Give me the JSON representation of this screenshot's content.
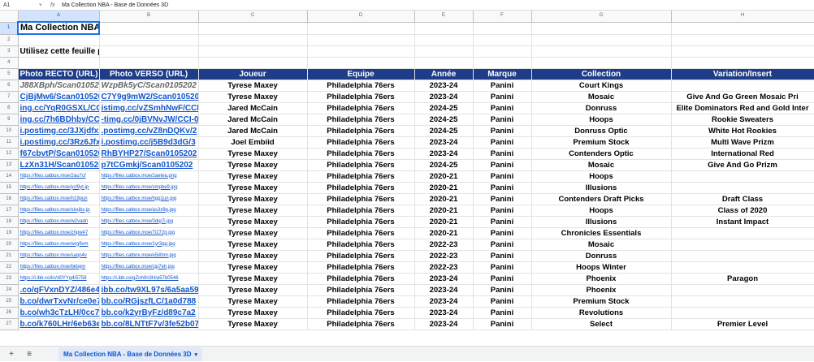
{
  "formula_bar": {
    "cell_ref": "A1",
    "fx": "fx",
    "value": "Ma Collection NBA - Base de Données 3D"
  },
  "sheet": {
    "columns": [
      "A",
      "B",
      "C",
      "D",
      "E",
      "F",
      "G",
      "H"
    ],
    "title": "Ma Collection NBA -",
    "instruction": "Utilisez cette feuille p",
    "headers": [
      "Photo RECTO (URL)",
      "Photo VERSO (URL)",
      "Joueur",
      "Equipe",
      "Année",
      "Marque",
      "Collection",
      "Variation/Insert"
    ],
    "rows": [
      {
        "n": "6",
        "a": "J88XBph/Scan010520",
        "b": "WzpBk5yC/Scan0105202",
        "j": "Tyrese Maxey",
        "e": "Philadelphia 76ers",
        "y": "2023-24",
        "m": "Panini",
        "c": "Court Kings",
        "v": ""
      },
      {
        "n": "7",
        "a": "CjBjMw6/Scan010520",
        "b": "C7Y9g9mW2/Scan0105202",
        "j": "Tyrese Maxey",
        "e": "Philadelphia 76ers",
        "y": "2023-24",
        "m": "Panini",
        "c": "Mosaic",
        "v": "Give And Go Green Mosaic Pri"
      },
      {
        "n": "8",
        "a": "ing.cc/YqR0GSXL/CCI",
        "b": "istimg.cc/vZSmhNwF/CCI-",
        "j": "Jared McCain",
        "e": "Philadelphia 76ers",
        "y": "2024-25",
        "m": "Panini",
        "c": "Donruss",
        "v": "Elite Dominators Red and Gold Inter"
      },
      {
        "n": "9",
        "a": "ing.cc/7h6BDhby/CCI",
        "b": "-timg.cc/0jBVNvJW/CCI-00",
        "j": "Jared McCain",
        "e": "Philadelphia 76ers",
        "y": "2024-25",
        "m": "Panini",
        "c": "Hoops",
        "v": "Rookie Sweaters"
      },
      {
        "n": "10",
        "a": "i.postimg.cc/3JXjdfxFi",
        "b": ".postimg.cc/vZ8nDQKv/2",
        "j": "Jared McCain",
        "e": "Philadelphia 76ers",
        "y": "2024-25",
        "m": "Panini",
        "c": "Donruss Optic",
        "v": "White Hot Rookies"
      },
      {
        "n": "11",
        "a": "i.postimg.cc/3Rz6Jfx",
        "b": "i.postimg.cc/j5B9d3dG/3",
        "j": "Joel Embiid",
        "e": "Philadelphia 76ers",
        "y": "2023-24",
        "m": "Panini",
        "c": "Premium Stock",
        "v": "Multi Wave Prizm"
      },
      {
        "n": "12",
        "a": "f67cbvtP/Scan010520",
        "b": "RhBYHP27/Scan0105202",
        "j": "Tyrese Maxey",
        "e": "Philadelphia 76ers",
        "y": "2023-24",
        "m": "Panini",
        "c": "Contenders Optic",
        "v": "International Red"
      },
      {
        "n": "13",
        "a": "LzXn31H/Scan010520",
        "b": "p7tCGmkj/Scan0105202",
        "j": "Tyrese Maxey",
        "e": "Philadelphia 76ers",
        "y": "2024-25",
        "m": "Panini",
        "c": "Mosaic",
        "v": "Give And Go Prizm"
      },
      {
        "n": "14",
        "a": "https://files.catbox.moe/2au7cf",
        "b": "https://files.catbox.moe/2aetea.png",
        "j": "Tyrese Maxey",
        "e": "Philadelphia 76ers",
        "y": "2020-21",
        "m": "Panini",
        "c": "Hoops",
        "v": ""
      },
      {
        "n": "15",
        "a": "https://files.catbox.moe/ycl9yt.jp",
        "b": "https://files.catbox.moe/smpbe9.jpg",
        "j": "Tyrese Maxey",
        "e": "Philadelphia 76ers",
        "y": "2020-21",
        "m": "Panini",
        "c": "Illusions",
        "v": ""
      },
      {
        "n": "16",
        "a": "https://files.catbox.moe/h19pun",
        "b": "https://files.catbox.moe/hgg1un.jpg",
        "j": "Tyrese Maxey",
        "e": "Philadelphia 76ers",
        "y": "2020-21",
        "m": "Panini",
        "c": "Contenders Draft Picks",
        "v": "Draft Class"
      },
      {
        "n": "17",
        "a": "https://files.catbox.moe/skxjbx.jp",
        "b": "https://files.catbox.moe/as3x9g.jpg",
        "j": "Tyrese Maxey",
        "e": "Philadelphia 76ers",
        "y": "2020-21",
        "m": "Panini",
        "c": "Hoops",
        "v": "Class of 2020"
      },
      {
        "n": "18",
        "a": "https://files.catbox.moe/w2vadn",
        "b": "https://files.catbox.moe/0dig7i.jpg",
        "j": "Tyrese Maxey",
        "e": "Philadelphia 76ers",
        "y": "2020-21",
        "m": "Panini",
        "c": "Illusions",
        "v": "Instant Impact"
      },
      {
        "n": "19",
        "a": "https://files.catbox.moe/zhpw47",
        "b": "https://files.catbox.moe/7i272p.jpg",
        "j": "Tyrese Maxey",
        "e": "Philadelphia 76ers",
        "y": "2020-21",
        "m": "Panini",
        "c": "Chronicles Essentials",
        "v": ""
      },
      {
        "n": "20",
        "a": "https://files.catbox.moe/wrg9vm",
        "b": "https://files.catbox.moe/1yr3gg.jpg",
        "j": "Tyrese Maxey",
        "e": "Philadelphia 76ers",
        "y": "2022-23",
        "m": "Panini",
        "c": "Mosaic",
        "v": ""
      },
      {
        "n": "21",
        "a": "https://files.catbox.moe/saqn4v",
        "b": "https://files.catbox.moe/e5il0mr.jpg",
        "j": "Tyrese Maxey",
        "e": "Philadelphia 76ers",
        "y": "2022-23",
        "m": "Panini",
        "c": "Donruss",
        "v": ""
      },
      {
        "n": "22",
        "a": "https://files.catbox.moe/bktejm",
        "b": "https://files.catbox.moe/cjp7eh.jpg",
        "j": "Tyrese Maxey",
        "e": "Philadelphia 76ers",
        "y": "2022-23",
        "m": "Panini",
        "c": "Hoops Winter",
        "v": ""
      },
      {
        "n": "23",
        "a": "https://i.ibb.co/kVd0YYg4/5758",
        "b": "https://i.ibb.co/gZnh0n3H/a57b0546",
        "j": "Tyrese Maxey",
        "e": "Philadelphia 76ers",
        "y": "2023-24",
        "m": "Panini",
        "c": "Phoenix",
        "v": "Paragon"
      },
      {
        "n": "24",
        "a": ".co/qFVxnDYZ/486e4",
        "b": "ibb.co/tw9XL97s/6a5aa59",
        "j": "Tyrese Maxey",
        "e": "Philadelphia 76ers",
        "y": "2023-24",
        "m": "Panini",
        "c": "Phoenix",
        "v": ""
      },
      {
        "n": "25",
        "a": "b.co/dwrTxvNr/ce0e7",
        "b": "bb.co/RGjszfLC/1a0d788",
        "j": "Tyrese Maxey",
        "e": "Philadelphia 76ers",
        "y": "2023-24",
        "m": "Panini",
        "c": "Premium Stock",
        "v": ""
      },
      {
        "n": "26",
        "a": "b.co/wh3cTzLH/0cc74",
        "b": "bb.co/k2yrByFz/d89c7a2",
        "j": "Tyrese Maxey",
        "e": "Philadelphia 76ers",
        "y": "2023-24",
        "m": "Panini",
        "c": "Revolutions",
        "v": ""
      },
      {
        "n": "27",
        "a": "b.co/k760LHr/6eb63e",
        "b": "bb.co/8LNTtF7v/3fe52b07",
        "j": "Tyrese Maxey",
        "e": "Philadelphia 76ers",
        "y": "2023-24",
        "m": "Panini",
        "c": "Select",
        "v": "Premier Level"
      }
    ]
  },
  "tabs": {
    "add": "+",
    "list": "≡",
    "active": "Ma Collection NBA - Base de Données 3D",
    "caret": "▾"
  }
}
